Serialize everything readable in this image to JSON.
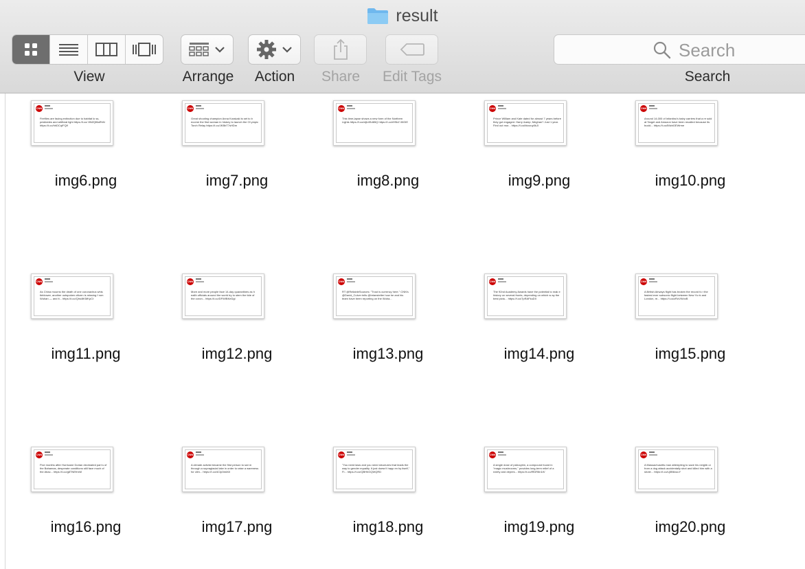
{
  "window": {
    "title": "result"
  },
  "toolbar": {
    "view_label": "View",
    "arrange_label": "Arrange",
    "action_label": "Action",
    "share_label": "Share",
    "edit_tags_label": "Edit Tags",
    "search_label": "Search",
    "search_placeholder": "Search",
    "view_modes": [
      "icon-view-icon",
      "list-view-icon",
      "column-view-icon",
      "cover-flow-icon"
    ],
    "active_view_mode": 0
  },
  "colors": {
    "folder": "#6fb8ee",
    "active_segment": "#6e6e6e",
    "cnn_red": "#cc0000"
  },
  "files": [
    {
      "name": "img6.png",
      "thumb_text": "Fireflies are facing extinction due to habitat lo ss, pesticides and artificial light https://t.co/ 8NZQf8aRhN https://t.co/hhDCqIFQlf"
    },
    {
      "name": "img7.png",
      "thumb_text": "Great shooting champion Anna Korakaki is set to b ecome the first woman in history to launch the Ol ympic Torch Relay https://t.co/JKBbT7sHDm"
    },
    {
      "name": "img8.png",
      "thumb_text": "This time-lapse shows a new form of the Northern Lights https://t.co/ctjb4Sd65Q https://t.co/r9SbZ i0IGIE"
    },
    {
      "name": "img9.png",
      "thumb_text": "Prince William and Kate dated for almost 7 years before they got engaged. Harry &amp; Meghan? Just 1 year. Find out mor... https://t.co/bkxzuy0kJI"
    },
    {
      "name": "img10.png",
      "thumb_text": "Around 14,000 of Infantino's baby carriers that a re sold at Target and Amazon have been recalled because its buckl... https://t.co/lMzbGEWrme"
    },
    {
      "name": "img11.png",
      "thumb_text": "As China mourns the death of one coronavirus whis tleblower, another outspoken citizen is missing f rom Wuhan — and it... https://t.co/Qhs4tKMKpCt"
    },
    {
      "name": "img12.png",
      "thumb_text": "More and more people face 14-day quarantines as h ealth officials around the world try to stem the tide of the coron... https://t.co/DFWIBKeDgl"
    },
    {
      "name": "img13.png",
      "thumb_text": "RT @ReliableSources: \"Trust is currency here.\" CNN's @David_Culver tells @brianstelter how he and his team have been reporting on the Wuha..."
    },
    {
      "name": "img14.png",
      "thumb_text": "The 92nd Academy Awards have the potential to mak e history on several fronts, depending on which w ay the best pictu... https://t.co/7pRAFkuDlI"
    },
    {
      "name": "img15.png",
      "thumb_text": "A British Airways flight has broken the record fo r the fastest ever subsonic flight between New Yo rk and London, re... https://t.co/zRoVWvzB"
    },
    {
      "name": "img16.png",
      "thumb_text": "Five months after Hurricane Dorian decimated part s of the Bahamas, desperate conditions still face much of the Abac... https://t.co/g8TNEfrIxM"
    },
    {
      "name": "img17.png",
      "thumb_text": "A climate activist became the first person to swi m through a supraglacial lake in order to raise a wareness for clim... https://t.co/4CIp0eAKll"
    },
    {
      "name": "img18.png",
      "thumb_text": "\"You need laws and you need structures that leads the way to gender equality. It just doesn't happ en by itself,\" Fi... https://t.co/QBHhGQWQRD"
    },
    {
      "name": "img19.png",
      "thumb_text": "A single dose of psilocybin, a compound found in \"magic mushrooms,\" provides long-term relief of a nxiety and depres... https://t.co/lRDR8n1tV"
    },
    {
      "name": "img20.png",
      "thumb_text": "A Massachusetts man attempting to save his neighb or from a dog attack accidentally shot and killed him with a shote... https://t.co/Lj5B6xuuY"
    }
  ]
}
